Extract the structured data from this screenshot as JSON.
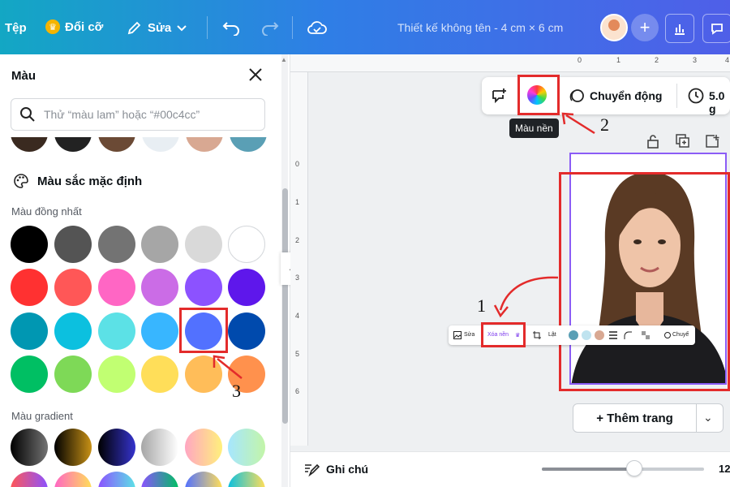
{
  "topbar": {
    "file_label": "Tệp",
    "resize_label": "Đổi cỡ",
    "edit_label": "Sửa",
    "title": "Thiết kế không tên - 4 cm × 6 cm",
    "gradient_start": "#13a7c4",
    "gradient_end": "#4f5fe8"
  },
  "color_panel": {
    "title": "Màu",
    "search_placeholder": "Thử “màu lam” hoặc “#00c4cc”",
    "recent_colors": [
      "#3a2a20",
      "#222222",
      "#6b4a35",
      "#e8eef3",
      "#d8a892",
      "#5a9fb5"
    ],
    "default_colors_heading": "Màu sắc mặc định",
    "solid_colors_label": "Màu đồng nhất",
    "solid_colors": [
      [
        "#000000",
        "#545454",
        "#737373",
        "#a6a6a6",
        "#d9d9d9",
        "#ffffff"
      ],
      [
        "#ff3131",
        "#ff5757",
        "#ff66c4",
        "#cb6ce6",
        "#8c52ff",
        "#5e17eb"
      ],
      [
        "#0097b2",
        "#0cc0df",
        "#5ce1e6",
        "#38b6ff",
        "#5271ff",
        "#004aad"
      ],
      [
        "#00bf63",
        "#7ed957",
        "#c1ff72",
        "#ffde59",
        "#ffbd59",
        "#ff914d"
      ]
    ],
    "gradient_colors_label": "Màu gradient",
    "gradient_colors": [
      "linear-gradient(90deg,#000,#737373)",
      "linear-gradient(90deg,#000,#c89116)",
      "linear-gradient(90deg,#000,#3533cd)",
      "linear-gradient(90deg,#a6a6a6,#fff)",
      "linear-gradient(90deg,#ffa6c2,#fff07c)",
      "linear-gradient(90deg,#a6e6ff,#c3f5a8)"
    ]
  },
  "float_toolbar": {
    "bg_color_tooltip": "Màu nền",
    "animate_label": "Chuyển động",
    "duration_label": "5.0 g"
  },
  "element_toolbar": {
    "edit_label": "Sửa",
    "remove_bg_label": "Xóa nền",
    "flip_label": "Lật",
    "animate_label": "Chuyể"
  },
  "annotations": [
    "1",
    "2",
    "3"
  ],
  "rulers": {
    "top": [
      "0",
      "1",
      "2",
      "3",
      "4"
    ],
    "left": [
      "0",
      "1",
      "2",
      "3",
      "4",
      "5",
      "6"
    ]
  },
  "add_page_label": "+ Thêm trang",
  "bottom_bar": {
    "notes_label": "Ghi chú",
    "zoom_value": "12",
    "zoom_fraction": 0.57
  },
  "accent": {
    "annotation_red": "#e32b2b",
    "selection_purple": "#8b5cf6"
  }
}
